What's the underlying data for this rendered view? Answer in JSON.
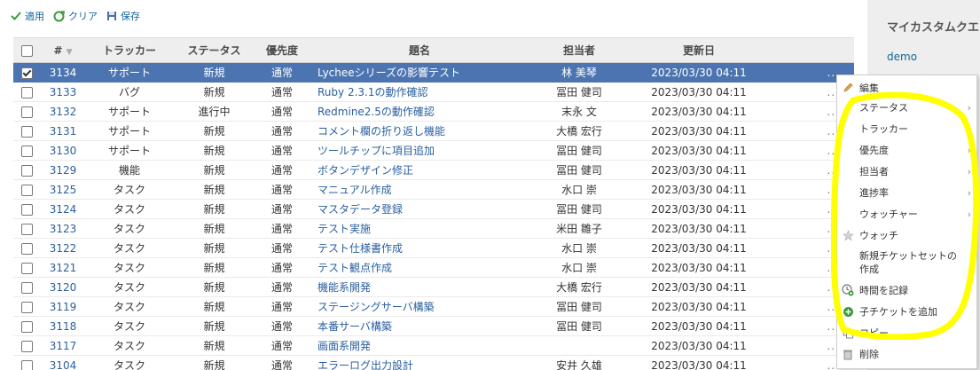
{
  "toolbar": {
    "apply": "適用",
    "clear": "クリア",
    "save": "保存"
  },
  "table": {
    "headers": {
      "id": "#",
      "tracker": "トラッカー",
      "status": "ステータス",
      "priority": "優先度",
      "subject": "題名",
      "assignee": "担当者",
      "updated": "更新日"
    },
    "rows": [
      {
        "id": "3134",
        "tracker": "サポート",
        "status": "新規",
        "priority": "通常",
        "subject": "Lycheeシリーズの影響テスト",
        "assignee": "林 美琴",
        "updated": "2023/03/30 04:11",
        "selected": true
      },
      {
        "id": "3133",
        "tracker": "バグ",
        "status": "新規",
        "priority": "通常",
        "subject": "Ruby 2.3.1の動作確認",
        "assignee": "冨田 健司",
        "updated": "2023/03/30 04:11"
      },
      {
        "id": "3132",
        "tracker": "サポート",
        "status": "進行中",
        "priority": "通常",
        "subject": "Redmine2.5の動作確認",
        "assignee": "末永 文",
        "updated": "2023/03/30 04:11"
      },
      {
        "id": "3131",
        "tracker": "サポート",
        "status": "新規",
        "priority": "通常",
        "subject": "コメント欄の折り返し機能",
        "assignee": "大橋 宏行",
        "updated": "2023/03/30 04:11"
      },
      {
        "id": "3130",
        "tracker": "サポート",
        "status": "新規",
        "priority": "通常",
        "subject": "ツールチップに項目追加",
        "assignee": "冨田 健司",
        "updated": "2023/03/30 04:11"
      },
      {
        "id": "3129",
        "tracker": "機能",
        "status": "新規",
        "priority": "通常",
        "subject": "ボタンデザイン修正",
        "assignee": "冨田 健司",
        "updated": "2023/03/30 04:11"
      },
      {
        "id": "3125",
        "tracker": "タスク",
        "status": "新規",
        "priority": "通常",
        "subject": "マニュアル作成",
        "assignee": "水口 崇",
        "updated": "2023/03/30 04:11"
      },
      {
        "id": "3124",
        "tracker": "タスク",
        "status": "新規",
        "priority": "通常",
        "subject": "マスタデータ登録",
        "assignee": "冨田 健司",
        "updated": "2023/03/30 04:11"
      },
      {
        "id": "3123",
        "tracker": "タスク",
        "status": "新規",
        "priority": "通常",
        "subject": "テスト実施",
        "assignee": "米田 雛子",
        "updated": "2023/03/30 04:11"
      },
      {
        "id": "3122",
        "tracker": "タスク",
        "status": "新規",
        "priority": "通常",
        "subject": "テスト仕様書作成",
        "assignee": "水口 崇",
        "updated": "2023/03/30 04:11"
      },
      {
        "id": "3121",
        "tracker": "タスク",
        "status": "新規",
        "priority": "通常",
        "subject": "テスト観点作成",
        "assignee": "水口 崇",
        "updated": "2023/03/30 04:11"
      },
      {
        "id": "3120",
        "tracker": "タスク",
        "status": "新規",
        "priority": "通常",
        "subject": "機能系開発",
        "assignee": "大橋 宏行",
        "updated": "2023/03/30 04:11"
      },
      {
        "id": "3119",
        "tracker": "タスク",
        "status": "新規",
        "priority": "通常",
        "subject": "ステージングサーバ構築",
        "assignee": "冨田 健司",
        "updated": "2023/03/30 04:11"
      },
      {
        "id": "3118",
        "tracker": "タスク",
        "status": "新規",
        "priority": "通常",
        "subject": "本番サーバ構築",
        "assignee": "冨田 健司",
        "updated": "2023/03/30 04:11"
      },
      {
        "id": "3117",
        "tracker": "タスク",
        "status": "新規",
        "priority": "通常",
        "subject": "画面系開発",
        "assignee": "",
        "updated": "2023/03/30 04:11"
      },
      {
        "id": "3104",
        "tracker": "タスク",
        "status": "新規",
        "priority": "通常",
        "subject": "エラーログ出力設計",
        "assignee": "安井 久雄",
        "updated": "2023/03/30 04:11"
      }
    ],
    "row_menu": "..."
  },
  "sidebar": {
    "title": "マイカスタムクエリ",
    "link": "demo"
  },
  "context_menu": {
    "edit": "編集",
    "status": "ステータス",
    "tracker": "トラッカー",
    "priority": "優先度",
    "assignee": "担当者",
    "progress": "進捗率",
    "watcher": "ウォッチャー",
    "watch": "ウォッチ",
    "new_ticket_set": "新規チケットセットの作成",
    "log_time": "時間を記録",
    "add_subtask": "子チケットを追加",
    "copy": "コピー",
    "delete": "削除",
    "chevron": "›"
  },
  "colors": {
    "selected_row": "#4c74b0",
    "link": "#2a5f9e",
    "highlight": "#ffff00"
  }
}
